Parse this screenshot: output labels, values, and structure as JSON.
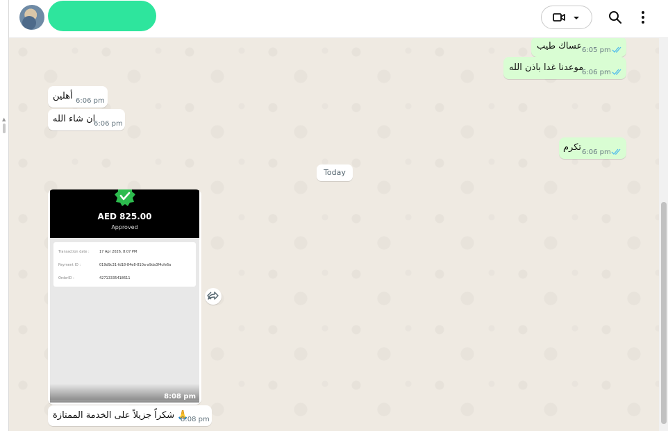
{
  "header": {
    "contact_name": "",
    "icons": {
      "avatar": "contact-avatar",
      "video": "video-camera-icon",
      "dropdown": "chevron-down-icon",
      "search": "search-icon",
      "menu": "more-vertical-icon"
    }
  },
  "colors": {
    "outgoing": "#d9fdd3",
    "incoming": "#ffffff",
    "chat_bg": "#efeae2",
    "tick": "#53bdeb",
    "name_redaction": "#2ee59d"
  },
  "messages": [
    {
      "direction": "out",
      "text": "عساك طيب",
      "time": "6:05 pm",
      "status": "read"
    },
    {
      "direction": "out",
      "text": "موعدنا غدا باذن الله",
      "time": "6:06 pm",
      "status": "read"
    },
    {
      "direction": "in",
      "text": "أهلين",
      "time": "6:06 pm"
    },
    {
      "direction": "in",
      "text": "ان شاء الله",
      "time": "6:06 pm"
    },
    {
      "direction": "out",
      "text": "تكرم",
      "time": "6:06 pm",
      "status": "read"
    }
  ],
  "date_divider": "Today",
  "image_message": {
    "direction": "in",
    "time": "8:08 pm",
    "receipt": {
      "amount": "AED 825.00",
      "status": "Approved",
      "rows": [
        {
          "label": "Transaction date :",
          "value": "17 Apr 2026, 8:07 PM"
        },
        {
          "label": "Payment ID :",
          "value": "019d9c31-fd18-84e8-810a-a9da3f4cfe6a"
        },
        {
          "label": "OrderID :",
          "value": "42713335418611"
        }
      ]
    }
  },
  "last_message": {
    "direction": "in",
    "text": "شكراً جزيلاً على الخدمة الممتازة 🙏",
    "time": "8:08 pm"
  }
}
